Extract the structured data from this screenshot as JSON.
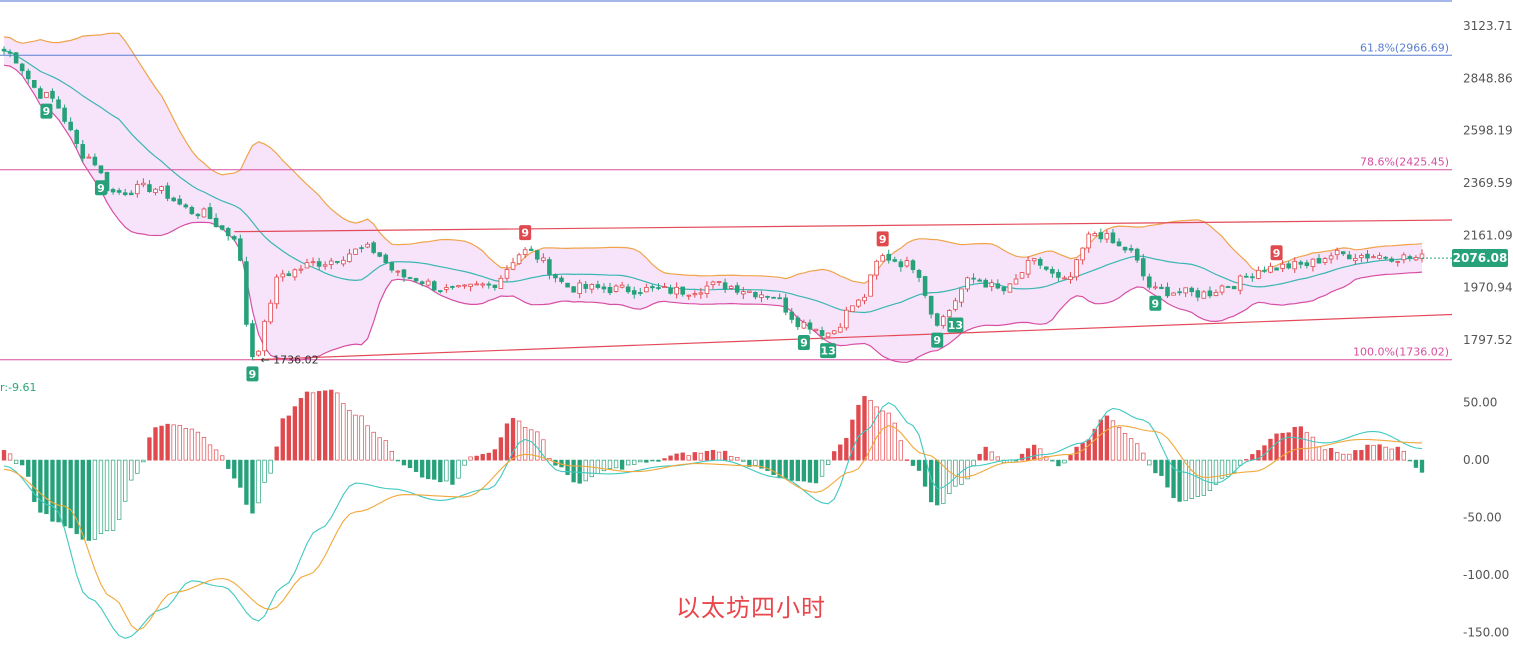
{
  "title": "以太坊四小时",
  "current_price": "2076.08",
  "colors": {
    "up": "#e04a4f",
    "down": "#26a17a",
    "band_fill": "#f7e4fb",
    "band_upper": "#f0a34a",
    "band_lower": "#d74fa4",
    "middle": "#3ab6b0",
    "fib_618": "#5a7fd0",
    "fib_786": "#d94fa1",
    "fib_100": "#d94fa1",
    "channel": "#e44b5a",
    "top_line": "#4a6fd0",
    "macd_fast": "#3fc9c0",
    "macd_slow": "#f0a83a"
  },
  "chart_data": [
    {
      "type": "candlestick",
      "name": "price",
      "y_ticks": [
        "3123.71",
        "2848.86",
        "2598.19",
        "2369.59",
        "2161.09",
        "1970.94",
        "1797.52"
      ],
      "ylim": [
        1690,
        3270
      ],
      "scale": "log",
      "fib_levels": [
        {
          "label": "61.8%(2966.69)",
          "value": 2966.69
        },
        {
          "label": "78.6%(2425.45)",
          "value": 2425.45
        },
        {
          "label": "100.0%(1736.02)",
          "value": 1736.02
        }
      ],
      "low_marker": {
        "label": "1736.02",
        "value": 1736.02
      },
      "td_markers": [
        {
          "text": "9",
          "type": "buy",
          "index": 7
        },
        {
          "text": "9",
          "type": "buy",
          "index": 16
        },
        {
          "text": "9",
          "type": "buy",
          "index": 41
        },
        {
          "text": "9",
          "type": "sell",
          "index": 86
        },
        {
          "text": "9",
          "type": "buy",
          "index": 132
        },
        {
          "text": "13",
          "type": "buy",
          "index": 136
        },
        {
          "text": "9",
          "type": "sell",
          "index": 145
        },
        {
          "text": "9",
          "type": "buy",
          "index": 154
        },
        {
          "text": "13",
          "type": "buy",
          "index": 157
        },
        {
          "text": "9",
          "type": "buy",
          "index": 190
        },
        {
          "text": "9",
          "type": "sell",
          "index": 210
        }
      ],
      "key_points": [
        {
          "index": 0,
          "close": 2990
        },
        {
          "index": 7,
          "close": 2760
        },
        {
          "index": 14,
          "close": 2480
        },
        {
          "index": 18,
          "close": 2330
        },
        {
          "index": 24,
          "close": 2350
        },
        {
          "index": 32,
          "close": 2250
        },
        {
          "index": 38,
          "close": 2160
        },
        {
          "index": 41,
          "close": 1750
        },
        {
          "index": 46,
          "close": 2020
        },
        {
          "index": 52,
          "close": 2060
        },
        {
          "index": 60,
          "close": 2110
        },
        {
          "index": 66,
          "close": 2010
        },
        {
          "index": 74,
          "close": 1960
        },
        {
          "index": 80,
          "close": 1980
        },
        {
          "index": 86,
          "close": 2100
        },
        {
          "index": 94,
          "close": 1970
        },
        {
          "index": 104,
          "close": 1965
        },
        {
          "index": 112,
          "close": 1960
        },
        {
          "index": 118,
          "close": 1980
        },
        {
          "index": 126,
          "close": 1950
        },
        {
          "index": 132,
          "close": 1850
        },
        {
          "index": 136,
          "close": 1820
        },
        {
          "index": 141,
          "close": 1920
        },
        {
          "index": 145,
          "close": 2080
        },
        {
          "index": 150,
          "close": 2050
        },
        {
          "index": 154,
          "close": 1860
        },
        {
          "index": 160,
          "close": 2000
        },
        {
          "index": 165,
          "close": 1960
        },
        {
          "index": 170,
          "close": 2060
        },
        {
          "index": 175,
          "close": 1990
        },
        {
          "index": 180,
          "close": 2170
        },
        {
          "index": 185,
          "close": 2110
        },
        {
          "index": 190,
          "close": 1960
        },
        {
          "index": 198,
          "close": 1950
        },
        {
          "index": 202,
          "close": 1980
        },
        {
          "index": 208,
          "close": 2040
        },
        {
          "index": 214,
          "close": 2050
        },
        {
          "index": 220,
          "close": 2090
        },
        {
          "index": 226,
          "close": 2085
        },
        {
          "index": 234,
          "close": 2076
        }
      ]
    },
    {
      "type": "histogram",
      "name": "MACD",
      "readout": "r:-9.61",
      "y_ticks": [
        "50.00",
        "0.00",
        "-50.00",
        "-100.00",
        "-150.00"
      ],
      "ylim": [
        -160,
        68
      ],
      "hist_points": [
        {
          "index": 0,
          "value": 8
        },
        {
          "index": 3,
          "value": -5
        },
        {
          "index": 6,
          "value": -45
        },
        {
          "index": 9,
          "value": -55
        },
        {
          "index": 14,
          "value": -70
        },
        {
          "index": 18,
          "value": -60
        },
        {
          "index": 22,
          "value": -10
        },
        {
          "index": 25,
          "value": 28
        },
        {
          "index": 28,
          "value": 32
        },
        {
          "index": 32,
          "value": 25
        },
        {
          "index": 35,
          "value": 10
        },
        {
          "index": 38,
          "value": -15
        },
        {
          "index": 41,
          "value": -45
        },
        {
          "index": 44,
          "value": -10
        },
        {
          "index": 46,
          "value": 35
        },
        {
          "index": 50,
          "value": 58
        },
        {
          "index": 54,
          "value": 60
        },
        {
          "index": 58,
          "value": 40
        },
        {
          "index": 62,
          "value": 20
        },
        {
          "index": 66,
          "value": -5
        },
        {
          "index": 70,
          "value": -15
        },
        {
          "index": 74,
          "value": -20
        },
        {
          "index": 77,
          "value": 2
        },
        {
          "index": 80,
          "value": 6
        },
        {
          "index": 84,
          "value": 35
        },
        {
          "index": 88,
          "value": 25
        },
        {
          "index": 91,
          "value": -5
        },
        {
          "index": 95,
          "value": -20
        },
        {
          "index": 100,
          "value": -8
        },
        {
          "index": 106,
          "value": -2
        },
        {
          "index": 112,
          "value": 5
        },
        {
          "index": 118,
          "value": 8
        },
        {
          "index": 124,
          "value": -5
        },
        {
          "index": 130,
          "value": -18
        },
        {
          "index": 134,
          "value": -20
        },
        {
          "index": 138,
          "value": 12
        },
        {
          "index": 142,
          "value": 55
        },
        {
          "index": 146,
          "value": 40
        },
        {
          "index": 150,
          "value": -5
        },
        {
          "index": 154,
          "value": -40
        },
        {
          "index": 158,
          "value": -20
        },
        {
          "index": 162,
          "value": 10
        },
        {
          "index": 166,
          "value": -3
        },
        {
          "index": 170,
          "value": 14
        },
        {
          "index": 174,
          "value": -5
        },
        {
          "index": 178,
          "value": 15
        },
        {
          "index": 182,
          "value": 38
        },
        {
          "index": 186,
          "value": 20
        },
        {
          "index": 190,
          "value": -10
        },
        {
          "index": 194,
          "value": -35
        },
        {
          "index": 198,
          "value": -30
        },
        {
          "index": 202,
          "value": -15
        },
        {
          "index": 206,
          "value": 5
        },
        {
          "index": 210,
          "value": 22
        },
        {
          "index": 214,
          "value": 28
        },
        {
          "index": 218,
          "value": 10
        },
        {
          "index": 222,
          "value": 6
        },
        {
          "index": 226,
          "value": 14
        },
        {
          "index": 230,
          "value": 10
        },
        {
          "index": 234,
          "value": -10
        }
      ],
      "fast_points": [
        {
          "index": 0,
          "value": -5
        },
        {
          "index": 8,
          "value": -40
        },
        {
          "index": 14,
          "value": -120
        },
        {
          "index": 20,
          "value": -155
        },
        {
          "index": 26,
          "value": -130
        },
        {
          "index": 31,
          "value": -105
        },
        {
          "index": 36,
          "value": -110
        },
        {
          "index": 42,
          "value": -140
        },
        {
          "index": 46,
          "value": -110
        },
        {
          "index": 52,
          "value": -60
        },
        {
          "index": 58,
          "value": -20
        },
        {
          "index": 64,
          "value": -25
        },
        {
          "index": 72,
          "value": -35
        },
        {
          "index": 80,
          "value": -25
        },
        {
          "index": 86,
          "value": 18
        },
        {
          "index": 92,
          "value": -10
        },
        {
          "index": 100,
          "value": -12
        },
        {
          "index": 110,
          "value": -5
        },
        {
          "index": 118,
          "value": 0
        },
        {
          "index": 128,
          "value": -15
        },
        {
          "index": 136,
          "value": -38
        },
        {
          "index": 142,
          "value": 25
        },
        {
          "index": 146,
          "value": 50
        },
        {
          "index": 150,
          "value": 30
        },
        {
          "index": 154,
          "value": -25
        },
        {
          "index": 160,
          "value": -5
        },
        {
          "index": 166,
          "value": 0
        },
        {
          "index": 172,
          "value": 5
        },
        {
          "index": 178,
          "value": 15
        },
        {
          "index": 183,
          "value": 45
        },
        {
          "index": 188,
          "value": 35
        },
        {
          "index": 194,
          "value": -10
        },
        {
          "index": 200,
          "value": -20
        },
        {
          "index": 206,
          "value": 0
        },
        {
          "index": 212,
          "value": 20
        },
        {
          "index": 218,
          "value": 15
        },
        {
          "index": 226,
          "value": 25
        },
        {
          "index": 234,
          "value": 10
        }
      ],
      "slow_points": [
        {
          "index": 0,
          "value": -8
        },
        {
          "index": 10,
          "value": -40
        },
        {
          "index": 18,
          "value": -120
        },
        {
          "index": 22,
          "value": -148
        },
        {
          "index": 28,
          "value": -115
        },
        {
          "index": 36,
          "value": -103
        },
        {
          "index": 44,
          "value": -130
        },
        {
          "index": 50,
          "value": -100
        },
        {
          "index": 58,
          "value": -45
        },
        {
          "index": 66,
          "value": -30
        },
        {
          "index": 76,
          "value": -32
        },
        {
          "index": 86,
          "value": 5
        },
        {
          "index": 94,
          "value": -5
        },
        {
          "index": 104,
          "value": -10
        },
        {
          "index": 114,
          "value": -3
        },
        {
          "index": 124,
          "value": -5
        },
        {
          "index": 134,
          "value": -28
        },
        {
          "index": 140,
          "value": -10
        },
        {
          "index": 146,
          "value": 30
        },
        {
          "index": 152,
          "value": 5
        },
        {
          "index": 158,
          "value": -15
        },
        {
          "index": 166,
          "value": -2
        },
        {
          "index": 176,
          "value": 5
        },
        {
          "index": 184,
          "value": 30
        },
        {
          "index": 190,
          "value": 25
        },
        {
          "index": 198,
          "value": -15
        },
        {
          "index": 206,
          "value": -10
        },
        {
          "index": 214,
          "value": 10
        },
        {
          "index": 224,
          "value": 18
        },
        {
          "index": 234,
          "value": 15
        }
      ]
    }
  ]
}
